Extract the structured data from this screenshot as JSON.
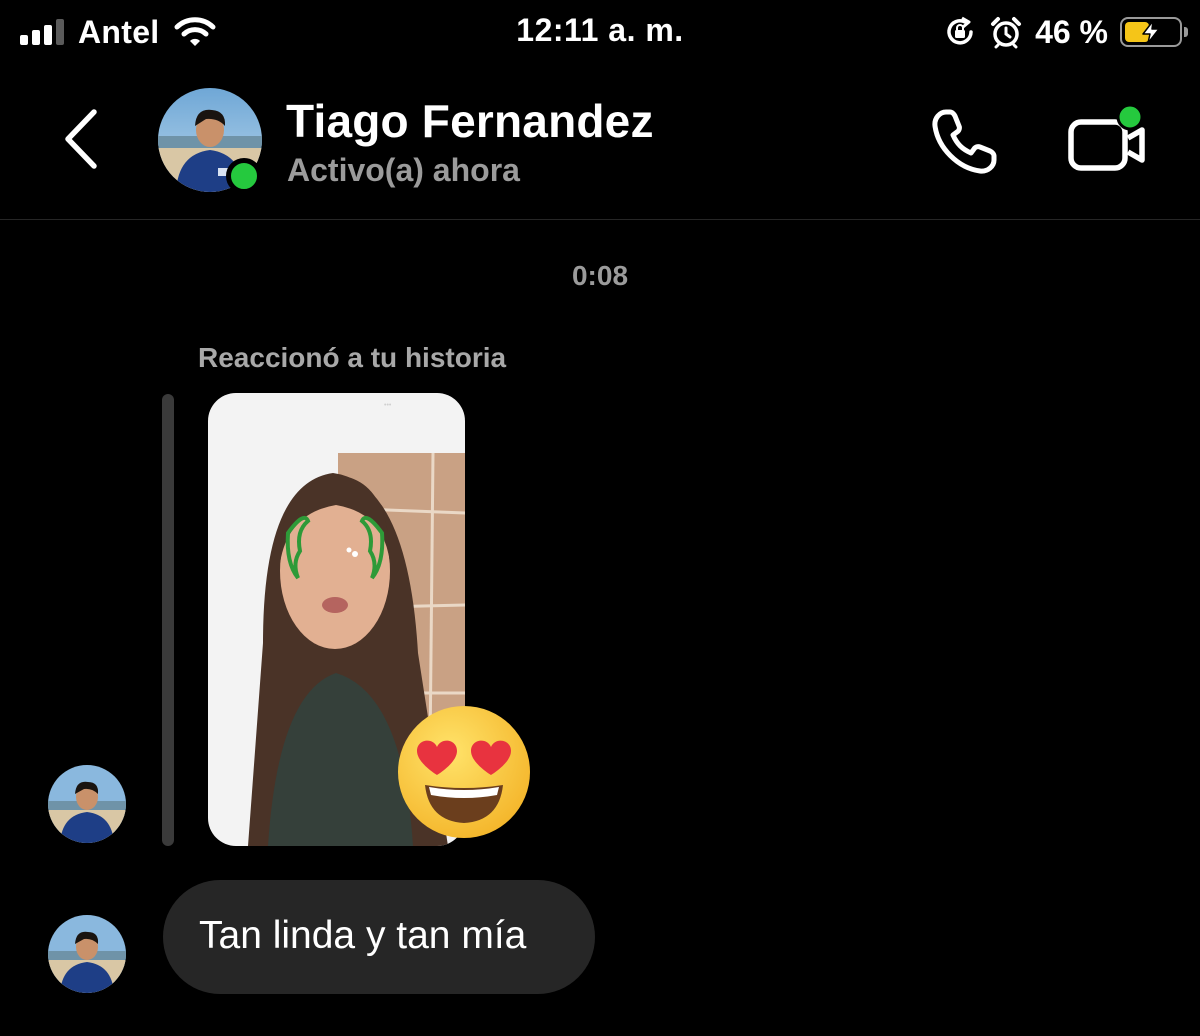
{
  "status_bar": {
    "carrier": "Antel",
    "time": "12:11 a. m.",
    "battery_percent": "46 %",
    "battery_level": 0.46,
    "signal_bars": 3,
    "icons": [
      "signal-icon",
      "wifi-icon",
      "orientation-lock-icon",
      "alarm-icon",
      "battery-charging-icon"
    ]
  },
  "header": {
    "contact_name": "Tiago Fernandez",
    "contact_status": "Activo(a) ahora",
    "icons": [
      "back-chevron-icon",
      "phone-icon",
      "video-camera-icon"
    ],
    "online_color": "#25c93e"
  },
  "chat": {
    "timestamp": "0:08",
    "reaction_label": "Reaccionó a tu historia",
    "reaction_emoji": "heart-eyes-emoji",
    "message_text": "Tan linda y tan mía",
    "bubble_color": "#262626"
  }
}
